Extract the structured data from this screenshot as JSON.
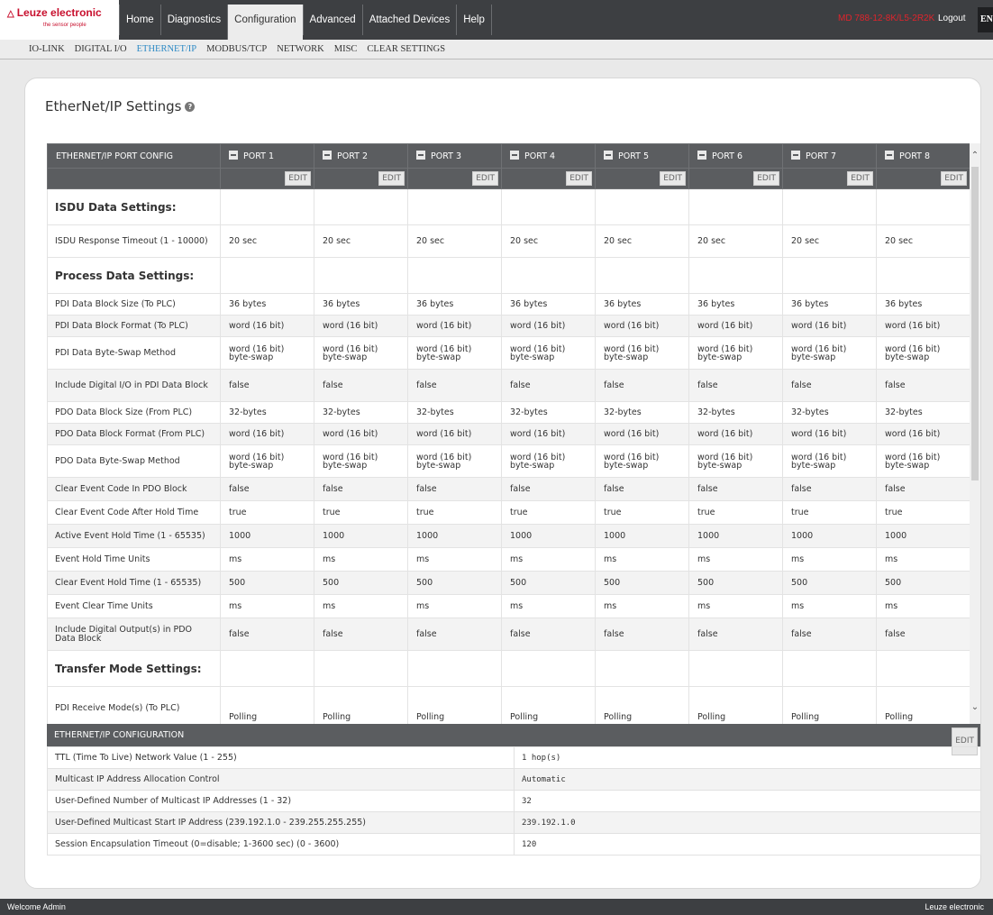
{
  "brand": {
    "name": "Leuze electronic",
    "tagline": "the sensor people"
  },
  "main_nav": [
    "Home",
    "Diagnostics",
    "Configuration",
    "Advanced",
    "Attached Devices",
    "Help"
  ],
  "main_nav_active": "Configuration",
  "device_name": "MD 788-12-8K/L5-2R2K",
  "logout": "Logout",
  "language": "EN",
  "sub_nav": [
    "IO-LINK",
    "DIGITAL I/O",
    "ETHERNET/IP",
    "MODBUS/TCP",
    "NETWORK",
    "MISC",
    "CLEAR SETTINGS"
  ],
  "sub_nav_active": "ETHERNET/IP",
  "page_title": "EtherNet/IP Settings",
  "port_config": {
    "header_label": "ETHERNET/IP PORT CONFIG",
    "ports": [
      "PORT 1",
      "PORT 2",
      "PORT 3",
      "PORT 4",
      "PORT 5",
      "PORT 6",
      "PORT 7",
      "PORT 8"
    ],
    "edit_label": "EDIT",
    "rows": [
      {
        "label": "ISDU Data Settings:",
        "section": true,
        "values": [
          "",
          "",
          "",
          "",
          "",
          "",
          "",
          ""
        ]
      },
      {
        "label": "ISDU Response Timeout (1 - 10000)",
        "values": [
          "20 sec",
          "20 sec",
          "20 sec",
          "20 sec",
          "20 sec",
          "20 sec",
          "20 sec",
          "20 sec"
        ]
      },
      {
        "label": "Process Data Settings:",
        "section": true,
        "values": [
          "",
          "",
          "",
          "",
          "",
          "",
          "",
          ""
        ]
      },
      {
        "label": "PDI Data Block Size (To PLC)",
        "values": [
          "36 bytes",
          "36 bytes",
          "36 bytes",
          "36 bytes",
          "36 bytes",
          "36 bytes",
          "36 bytes",
          "36 bytes"
        ]
      },
      {
        "label": "PDI Data Block Format (To PLC)",
        "values": [
          "word (16 bit)",
          "word (16 bit)",
          "word (16 bit)",
          "word (16 bit)",
          "word (16 bit)",
          "word (16 bit)",
          "word (16 bit)",
          "word (16 bit)"
        ]
      },
      {
        "label": "PDI Data Byte-Swap Method",
        "values": [
          "word (16 bit) byte-swap",
          "word (16 bit) byte-swap",
          "word (16 bit) byte-swap",
          "word (16 bit) byte-swap",
          "word (16 bit) byte-swap",
          "word (16 bit) byte-swap",
          "word (16 bit) byte-swap",
          "word (16 bit) byte-swap"
        ]
      },
      {
        "label": "Include Digital I/O in PDI Data Block",
        "values": [
          "false",
          "false",
          "false",
          "false",
          "false",
          "false",
          "false",
          "false"
        ]
      },
      {
        "label": "PDO Data Block Size (From PLC)",
        "values": [
          "32-bytes",
          "32-bytes",
          "32-bytes",
          "32-bytes",
          "32-bytes",
          "32-bytes",
          "32-bytes",
          "32-bytes"
        ]
      },
      {
        "label": "PDO Data Block Format (From PLC)",
        "values": [
          "word (16 bit)",
          "word (16 bit)",
          "word (16 bit)",
          "word (16 bit)",
          "word (16 bit)",
          "word (16 bit)",
          "word (16 bit)",
          "word (16 bit)"
        ]
      },
      {
        "label": "PDO Data Byte-Swap Method",
        "values": [
          "word (16 bit) byte-swap",
          "word (16 bit) byte-swap",
          "word (16 bit) byte-swap",
          "word (16 bit) byte-swap",
          "word (16 bit) byte-swap",
          "word (16 bit) byte-swap",
          "word (16 bit) byte-swap",
          "word (16 bit) byte-swap"
        ]
      },
      {
        "label": "Clear Event Code In PDO Block",
        "values": [
          "false",
          "false",
          "false",
          "false",
          "false",
          "false",
          "false",
          "false"
        ]
      },
      {
        "label": "Clear Event Code After Hold Time",
        "values": [
          "true",
          "true",
          "true",
          "true",
          "true",
          "true",
          "true",
          "true"
        ]
      },
      {
        "label": "Active Event Hold Time (1 - 65535)",
        "values": [
          "1000",
          "1000",
          "1000",
          "1000",
          "1000",
          "1000",
          "1000",
          "1000"
        ]
      },
      {
        "label": "Event Hold Time Units",
        "values": [
          "ms",
          "ms",
          "ms",
          "ms",
          "ms",
          "ms",
          "ms",
          "ms"
        ]
      },
      {
        "label": "Clear Event Hold Time (1 - 65535)",
        "values": [
          "500",
          "500",
          "500",
          "500",
          "500",
          "500",
          "500",
          "500"
        ]
      },
      {
        "label": "Event Clear Time Units",
        "values": [
          "ms",
          "ms",
          "ms",
          "ms",
          "ms",
          "ms",
          "ms",
          "ms"
        ]
      },
      {
        "label": "Include Digital Output(s) in PDO Data Block",
        "values": [
          "false",
          "false",
          "false",
          "false",
          "false",
          "false",
          "false",
          "false"
        ]
      },
      {
        "label": "Transfer Mode Settings:",
        "section": true,
        "values": [
          "",
          "",
          "",
          "",
          "",
          "",
          "",
          ""
        ]
      },
      {
        "label": "PDI Receive Mode(s) (To PLC)",
        "values": [
          "Polling",
          "Polling",
          "Polling",
          "Polling",
          "Polling",
          "Polling",
          "Polling",
          "Polling"
        ]
      }
    ]
  },
  "eip_config": {
    "header_label": "ETHERNET/IP CONFIGURATION",
    "edit_label": "EDIT",
    "rows": [
      {
        "label": "TTL (Time To Live) Network Value (1 - 255)",
        "value": "1 hop(s)"
      },
      {
        "label": "Multicast IP Address Allocation Control",
        "value": "Automatic"
      },
      {
        "label": "User-Defined Number of Multicast IP Addresses (1 - 32)",
        "value": "32"
      },
      {
        "label": "User-Defined Multicast Start IP Address (239.192.1.0 - 239.255.255.255)",
        "value": "239.192.1.0"
      },
      {
        "label": "Session Encapsulation Timeout (0=disable; 1-3600 sec) (0 - 3600)",
        "value": "120"
      }
    ]
  },
  "footer": {
    "welcome": "Welcome Admin",
    "brand": "Leuze electronic"
  },
  "colors": {
    "brand_red": "#c8102e",
    "accent_blue": "#2e8ac5",
    "header_gray": "#5b5d60",
    "topbar": "#3d3f42"
  }
}
